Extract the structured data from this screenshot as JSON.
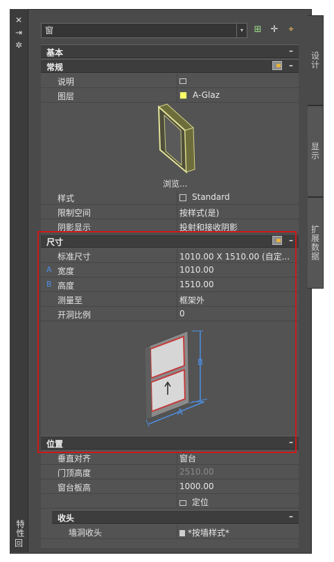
{
  "titlebar": {
    "title": "特性",
    "close_glyph": "✕",
    "pin_glyph": "⇥",
    "options_glyph": "✲",
    "bottom_glyph": "回"
  },
  "side_tabs": [
    {
      "label": "设计",
      "active": true
    },
    {
      "label": "显示",
      "active": false
    },
    {
      "label": "扩展数据",
      "active": false
    }
  ],
  "object_select": {
    "value": "窗",
    "arrow": "▾"
  },
  "toolbar": {
    "btn1_glyph": "⊞",
    "btn2_glyph": "✛",
    "btn3_glyph": "⌖"
  },
  "sections": {
    "basic": "基本",
    "general": "常规",
    "dimensions": "尺寸",
    "location": "位置",
    "end": "收头",
    "collapse": "–"
  },
  "general_rows": [
    {
      "key": "说明",
      "value": ""
    },
    {
      "key": "图层",
      "value": "A-Glaz",
      "swatch_color": "#ffff66"
    }
  ],
  "browse_label": "浏览...",
  "style_rows": [
    {
      "key": "样式",
      "value": "Standard"
    },
    {
      "key": "限制空间",
      "value": "按样式(是)"
    },
    {
      "key": "阴影显示",
      "value": "投射和接收阴影"
    }
  ],
  "dim_rows": [
    {
      "marker": "",
      "key": "标准尺寸",
      "value": "1010.00   X   1510.00 (自定..."
    },
    {
      "marker": "A",
      "key": "宽度",
      "value": "1010.00"
    },
    {
      "marker": "B",
      "key": "高度",
      "value": "1510.00"
    },
    {
      "marker": "",
      "key": "测量至",
      "value": "框架外"
    },
    {
      "marker": "",
      "key": "开洞比例",
      "value": "0"
    }
  ],
  "diagram_labels": {
    "a": "A",
    "b": "B"
  },
  "location_rows": [
    {
      "key": "垂直对齐",
      "value": "窗台",
      "disabled": false
    },
    {
      "key": "门顶高度",
      "value": "2510.00",
      "disabled": true
    },
    {
      "key": "窗台板高",
      "value": "1000.00",
      "disabled": false
    },
    {
      "key": "",
      "value": "定位",
      "disabled": false
    }
  ],
  "end_rows": [
    {
      "key": "墙洞收头",
      "value": "*按墙样式*"
    }
  ]
}
